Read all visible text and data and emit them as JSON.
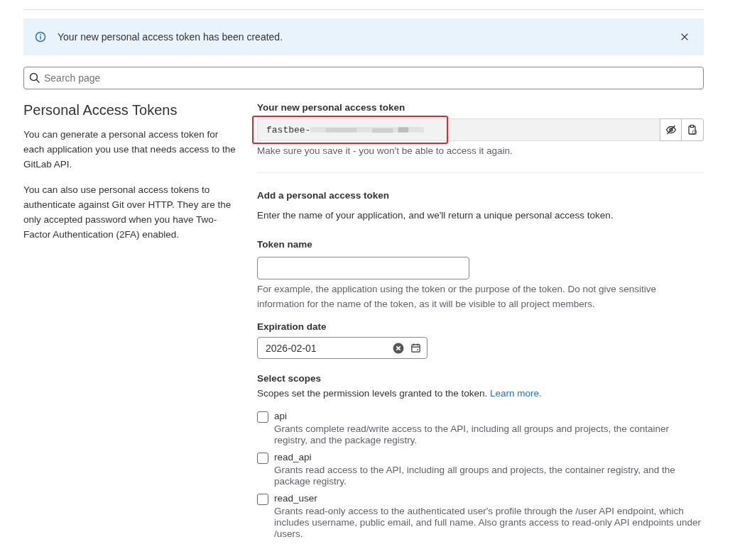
{
  "alert": {
    "message": "Your new personal access token has been created."
  },
  "search": {
    "placeholder": "Search page"
  },
  "intro": {
    "title": "Personal Access Tokens",
    "paragraphs": [
      "You can generate a personal access token for each application you use that needs access to the GitLab API.",
      "You can also use personal access tokens to authenticate against Git over HTTP. They are the only accepted password when you have Two-Factor Authentication (2FA) enabled."
    ]
  },
  "new_token": {
    "label": "Your new personal access token",
    "value": "fastbee-",
    "redacted": true,
    "highlighted": true,
    "help": "Make sure you save it - you won't be able to access it again."
  },
  "form": {
    "title": "Add a personal access token",
    "description": "Enter the name of your application, and we'll return a unique personal access token.",
    "token_name": {
      "label": "Token name",
      "help": "For example, the application using the token or the purpose of the token. Do not give sensitive information for the name of the token, as it will be visible to all project members."
    },
    "expiration": {
      "label": "Expiration date",
      "value": "2026-02-01"
    },
    "scopes": {
      "title": "Select scopes",
      "description": "Scopes set the permission levels granted to the token.",
      "link": "Learn more.",
      "items": [
        {
          "name": "api",
          "checked": false,
          "description": "Grants complete read/write access to the API, including all groups and projects, the container registry, and the package registry."
        },
        {
          "name": "read_api",
          "checked": false,
          "description": "Grants read access to the API, including all groups and projects, the container registry, and the package registry."
        },
        {
          "name": "read_user",
          "checked": false,
          "description": "Grants read-only access to the authenticated user's profile through the /user API endpoint, which includes username, public email, and full name. Also grants access to read-only API endpoints under /users."
        }
      ]
    }
  }
}
